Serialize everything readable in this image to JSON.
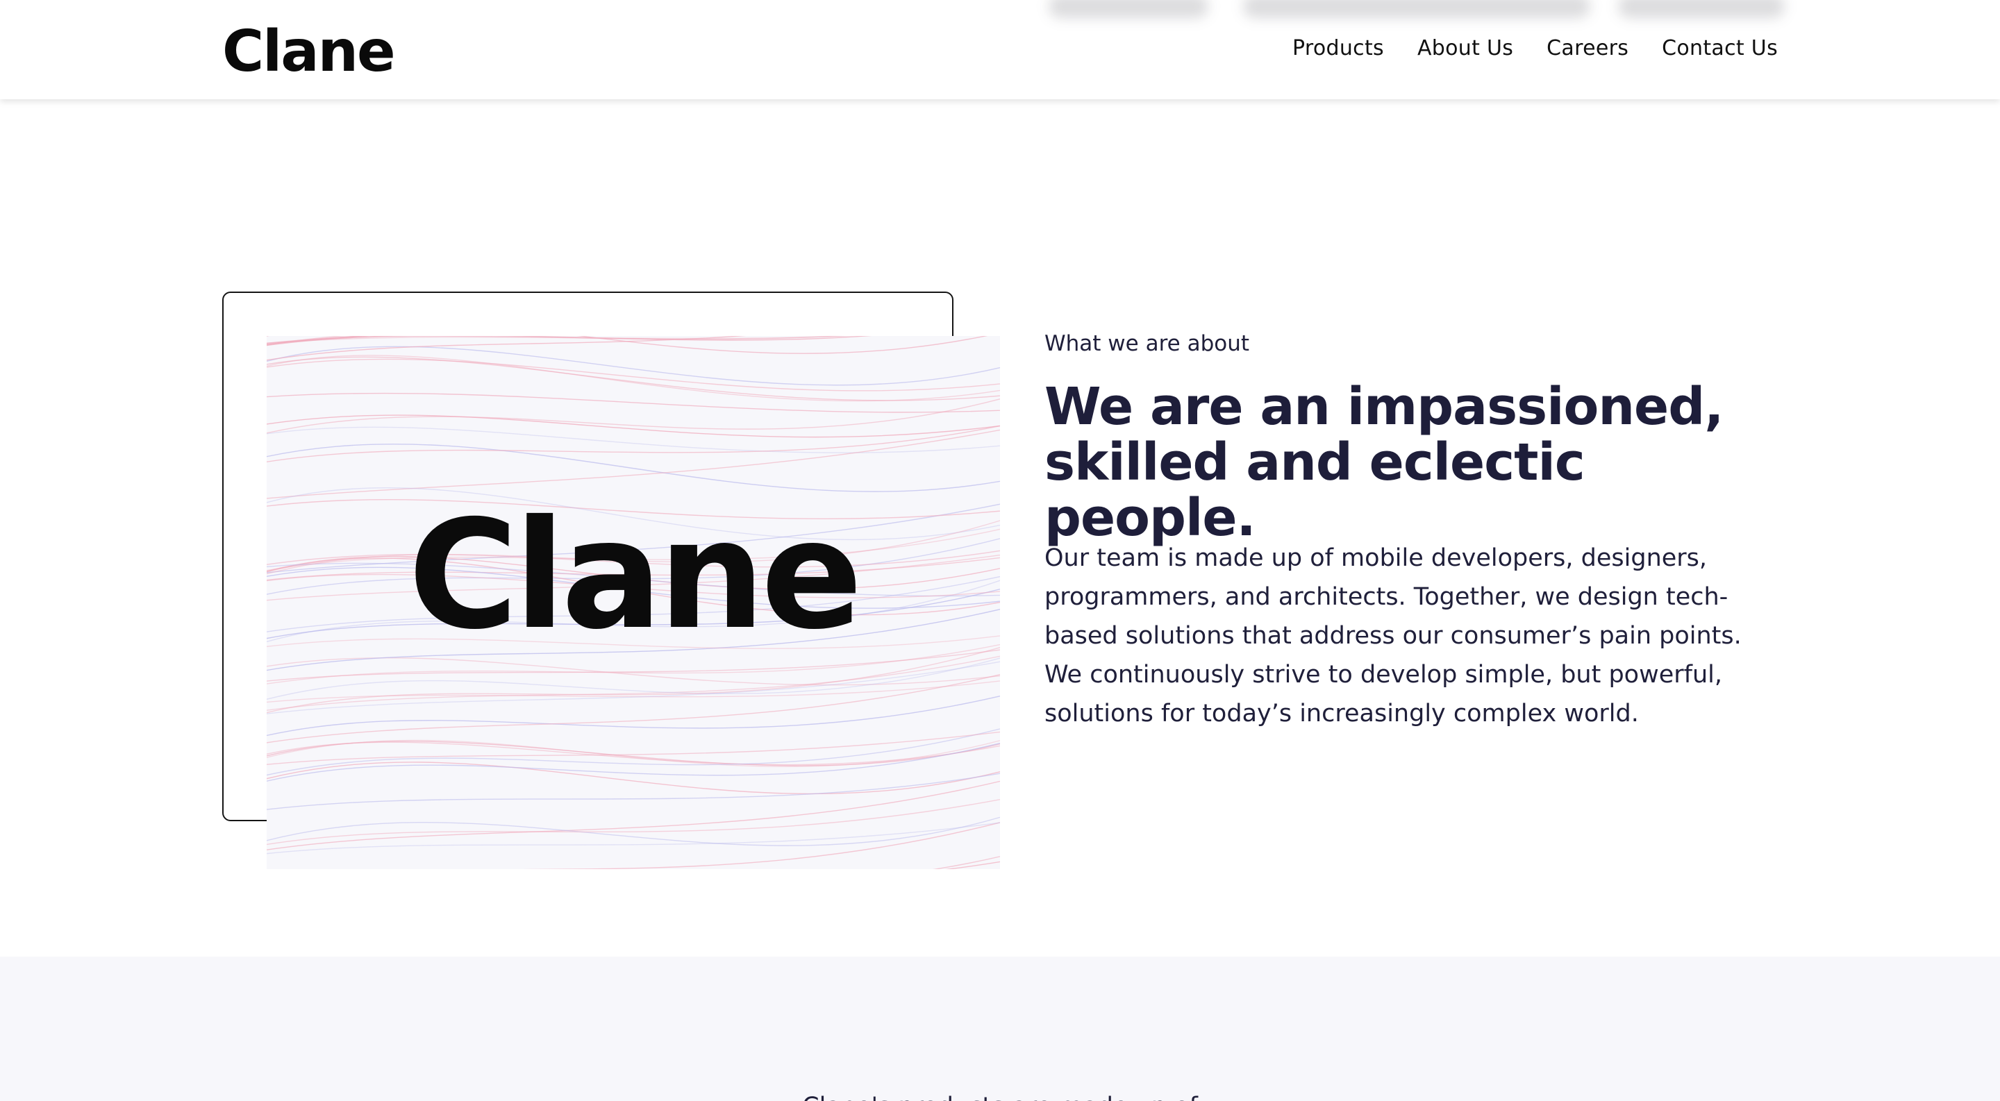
{
  "brand": {
    "logo_text": "Clane"
  },
  "nav": {
    "items": [
      "Products",
      "About Us",
      "Careers",
      "Contact Us"
    ]
  },
  "about": {
    "image_logo_text": "Clane",
    "eyebrow": "What we are about",
    "headline": "We are an impassioned, skilled and eclectic people.",
    "body": "Our team is made up of mobile developers, designers, programmers, and architects. Together, we design tech-based solutions that address our consumer’s pain points. We continuously strive to develop simple, but powerful, solutions for today’s increasingly complex world."
  },
  "next_section": {
    "title": "Clane's products are made up of"
  },
  "colors": {
    "text_dark": "#1e1e3a",
    "section_bg": "#f7f7fb",
    "line_pink": "#f0a9bb",
    "line_blue": "#b9b9ec"
  }
}
